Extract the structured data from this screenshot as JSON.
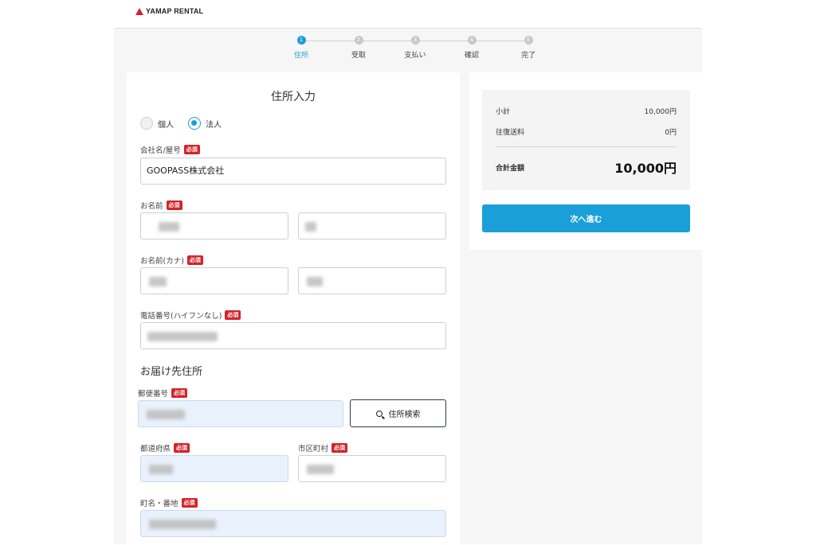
{
  "brand": {
    "name": "YAMAP RENTAL",
    "accent": "#d2232a"
  },
  "stepper": {
    "steps": [
      {
        "num": "1",
        "label": "住所"
      },
      {
        "num": "2",
        "label": "受取"
      },
      {
        "num": "3",
        "label": "支払い"
      },
      {
        "num": "4",
        "label": "確認"
      },
      {
        "num": "5",
        "label": "完了"
      }
    ],
    "active_index": 0,
    "active_color": "#1a9fd9"
  },
  "form": {
    "title": "住所入力",
    "entity_options": [
      "個人",
      "法人"
    ],
    "entity_selected": "法人",
    "required_badge": "必須",
    "company_label": "会社名/屋号",
    "company_value": "GOOPASS株式会社",
    "name_label": "お名前",
    "kana_label": "お名前(カナ)",
    "phone_label": "電話番号(ハイフンなし)",
    "delivery_heading": "お届け先住所",
    "postal_label": "郵便番号",
    "search_button": "住所検索",
    "prefecture_label": "都道府県",
    "city_label": "市区町村",
    "street_label": "町名・番地"
  },
  "summary": {
    "subtotal_label": "小計",
    "subtotal_value": "10,000円",
    "shipping_label": "往復送料",
    "shipping_value": "0円",
    "total_label": "合計金額",
    "total_value": "10,000円",
    "next_button": "次へ進む"
  }
}
